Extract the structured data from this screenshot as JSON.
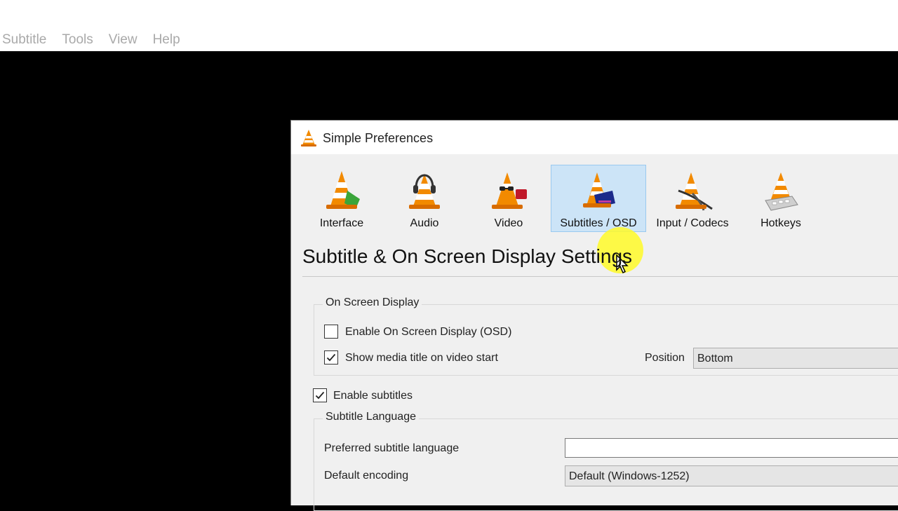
{
  "menubar": {
    "items": [
      "Subtitle",
      "Tools",
      "View",
      "Help"
    ]
  },
  "dialog": {
    "title": "Simple Preferences",
    "icon": "vlc-cone-icon",
    "categories": [
      {
        "label": "Interface",
        "icon": "interface-cone-icon",
        "selected": false
      },
      {
        "label": "Audio",
        "icon": "audio-cone-headphones-icon",
        "selected": false
      },
      {
        "label": "Video",
        "icon": "video-cone-glasses-icon",
        "selected": false
      },
      {
        "label": "Subtitles / OSD",
        "icon": "subtitles-cone-icon",
        "selected": true
      },
      {
        "label": "Input / Codecs",
        "icon": "codecs-cone-icon",
        "selected": false
      },
      {
        "label": "Hotkeys",
        "icon": "hotkeys-cone-icon",
        "selected": false
      }
    ],
    "section_title": "Subtitle & On Screen Display Settings",
    "osd_group": {
      "legend": "On Screen Display",
      "enable_osd": {
        "label": "Enable On Screen Display (OSD)",
        "checked": false
      },
      "show_media_title": {
        "label": "Show media title on video start",
        "checked": true
      },
      "position_label": "Position",
      "position_value": "Bottom"
    },
    "enable_subtitles": {
      "label": "Enable subtitles",
      "checked": true
    },
    "subtitle_language_group": {
      "legend": "Subtitle Language",
      "preferred_label": "Preferred subtitle language",
      "preferred_value": "",
      "encoding_label": "Default encoding",
      "encoding_value": "Default (Windows-1252)"
    }
  },
  "colors": {
    "selected_tab_bg": "#cce4f7",
    "selected_tab_border": "#99c9ef",
    "cone_orange": "#f28a00",
    "cursor_highlight": "#fffa28"
  }
}
